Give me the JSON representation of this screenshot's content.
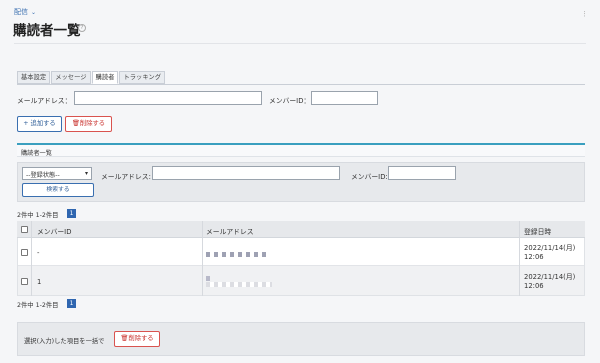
{
  "breadcrumb": {
    "label": "配信"
  },
  "page": {
    "title": "購読者一覧",
    "help_icon": "?"
  },
  "tabs": [
    {
      "label": "基本設定",
      "active": false
    },
    {
      "label": "メッセージ",
      "active": false
    },
    {
      "label": "購読者",
      "active": true
    },
    {
      "label": "トラッキング",
      "active": false
    }
  ],
  "add_form": {
    "email_label": "メールアドレス：",
    "member_label": "メンバーID：",
    "add_button": "+ 追加する",
    "delete_button": "削除する"
  },
  "list_panel": {
    "title": "購読者一覧"
  },
  "search": {
    "status_select": "--登録状態--",
    "email_label": "メールアドレス:",
    "member_label": "メンバーID:",
    "search_button": "検索する"
  },
  "pagination": {
    "count_text": "2件中 1-2件目",
    "current_page": "1"
  },
  "table": {
    "headers": {
      "member_id": "メンバーID",
      "email": "メールアドレス",
      "registered": "登録日時"
    },
    "rows": [
      {
        "member_id": "-",
        "date": "2022/11/14(月)",
        "time": "12:06"
      },
      {
        "member_id": "1",
        "date": "2022/11/14(月)",
        "time": "12:06"
      }
    ]
  },
  "bulk_action": {
    "label": "選択(入力)した項目を一括で",
    "delete_button": "削除する"
  },
  "colors": {
    "accent": "#2f66b0",
    "danger": "#c9302c",
    "panel_border": "#3a9fbf"
  }
}
